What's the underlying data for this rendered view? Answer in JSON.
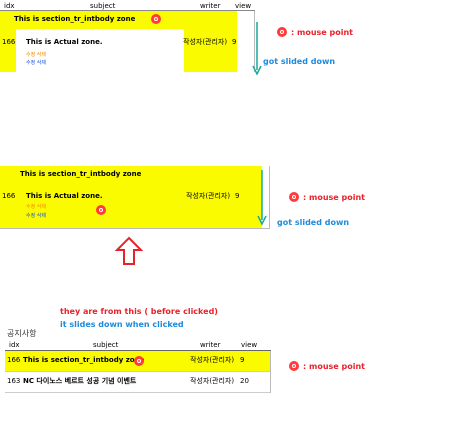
{
  "colors": {
    "highlight": "#fbfb00",
    "annotation_red": "#e8222b",
    "annotation_blue": "#1e8bdc",
    "arrow_teal": "#19a89a",
    "small_link_orange": "#f08a00",
    "small_link_blue": "#1a4fd8"
  },
  "icons": [
    "mouse-point-icon",
    "arrow-down-icon",
    "arrow-up-outline-icon"
  ],
  "panel1": {
    "header": {
      "idx": "idx",
      "subject": "subject",
      "writer": "writer",
      "view": "view"
    },
    "zone_label": "This is section_tr_intbody zone",
    "row_idx": "166",
    "actual_zone": "This is Actual zone.",
    "link1": "수정  삭제",
    "link2": "수정  삭제",
    "writer": "작성자(관리자)",
    "views": "9"
  },
  "panel2": {
    "zone_label": "This is section_tr_intbody zone",
    "row_idx": "166",
    "actual_zone": "This is Actual zone.",
    "link1": "수정  삭제",
    "link2": "수정  삭제",
    "writer": "작성자(관리자)",
    "views": "9"
  },
  "panel3": {
    "title": "공지사항",
    "header": {
      "idx": "idx",
      "subject": "subject",
      "writer": "writer",
      "view": "view"
    },
    "row1": {
      "idx": "166",
      "subject": "This is section_tr_intbody zone",
      "writer": "작성자(관리자)",
      "views": "9"
    },
    "row2": {
      "idx": "163",
      "subject": "NC 다이노스 베르트 성공 기념 이벤트",
      "writer": "작성자(관리자)",
      "views": "20"
    }
  },
  "annotations": {
    "mouse_point_1": ": mouse point",
    "mouse_point_2": ": mouse point",
    "mouse_point_3": ": mouse point",
    "slid_1": "got slided down",
    "slid_2": "got slided down",
    "caption_red": "they are from this ( before clicked)",
    "caption_blue": "it slides down when clicked"
  }
}
